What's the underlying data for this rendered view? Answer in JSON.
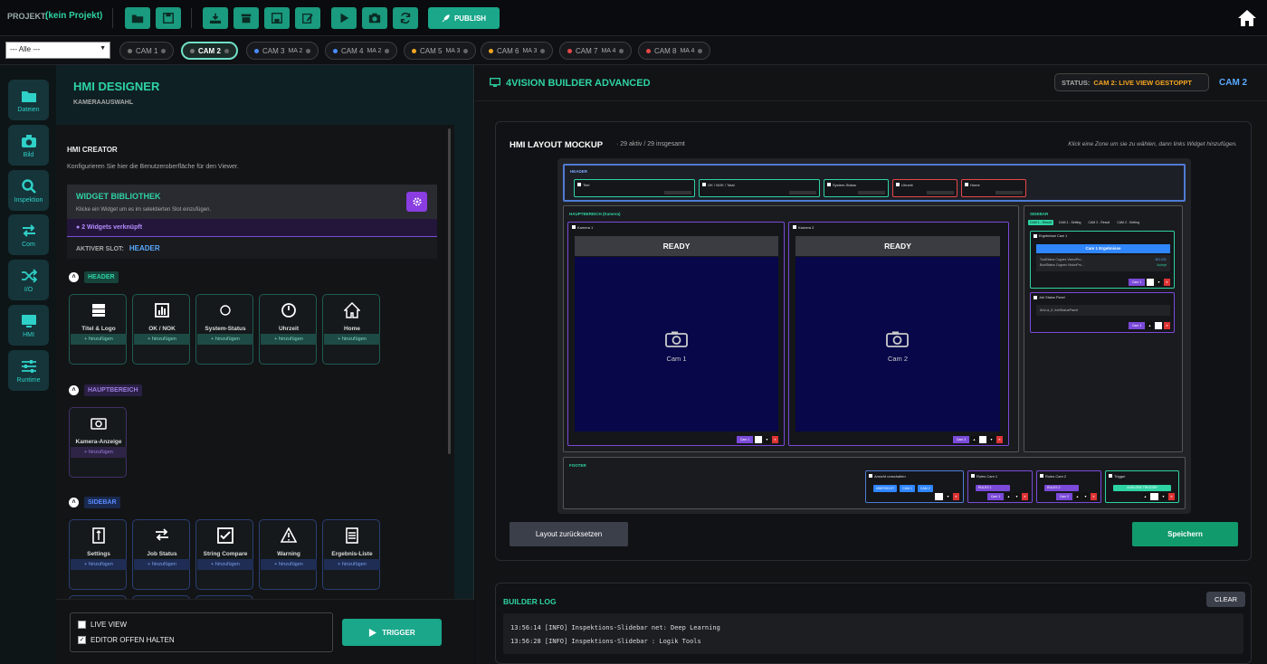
{
  "topbar": {
    "project_label": "PROJEKT:",
    "project_name": "(kein Projekt)",
    "publish_label": "PUBLISH"
  },
  "camfilter": {
    "selected": "--- Alle ---"
  },
  "camtabs": [
    {
      "label": "CAM 1",
      "ma": "",
      "dot": "#777777",
      "active": false
    },
    {
      "label": "CAM 2",
      "ma": "",
      "dot": "#777777",
      "active": true
    },
    {
      "label": "CAM 3",
      "ma": "MA 2",
      "dot": "#4a8cff",
      "active": false
    },
    {
      "label": "CAM 4",
      "ma": "MA 2",
      "dot": "#4a8cff",
      "active": false
    },
    {
      "label": "CAM 5",
      "ma": "MA 3",
      "dot": "#f5a623",
      "active": false
    },
    {
      "label": "CAM 6",
      "ma": "MA 3",
      "dot": "#f5a623",
      "active": false
    },
    {
      "label": "CAM 7",
      "ma": "MA 4",
      "dot": "#e54848",
      "active": false
    },
    {
      "label": "CAM 8",
      "ma": "MA 4",
      "dot": "#e54848",
      "active": false
    }
  ],
  "sidenav": [
    {
      "label": "Dateien",
      "icon": "folder-icon"
    },
    {
      "label": "Bild",
      "icon": "camera-icon"
    },
    {
      "label": "Inspektion",
      "icon": "search-icon"
    },
    {
      "label": "Com",
      "icon": "exchange-icon"
    },
    {
      "label": "I/O",
      "icon": "shuffle-icon"
    },
    {
      "label": "HMI",
      "icon": "monitor-icon"
    },
    {
      "label": "Runtime",
      "icon": "sliders-icon"
    }
  ],
  "designer": {
    "title": "HMI DESIGNER",
    "subtitle": "KAMERAAUSWAHL",
    "creator_title": "HMI CREATOR",
    "creator_desc": "Konfigurieren Sie hier die Benutzeroberfläche für den Viewer.",
    "library_title": "WIDGET BIBLIOTHEK",
    "library_desc": "Klicke ein Widget um es im selektierten Slot einzufügen.",
    "linked": "2 Widgets verknüpft",
    "active_slot_label": "AKTIVER SLOT:",
    "active_slot_value": "HEADER",
    "add_label": "+ hinzufügen",
    "sections": [
      {
        "label": "HEADER",
        "widgets": [
          "Titel & Logo",
          "OK / NOK",
          "System-Status",
          "Uhrzeit",
          "Home"
        ]
      },
      {
        "label": "HAUPTBEREICH",
        "widgets": [
          "Kamera-Anzeige"
        ]
      },
      {
        "label": "SIDEBAR",
        "widgets": [
          "Settings",
          "Job Status",
          "String Compare",
          "Warning",
          "Ergebnis-Liste"
        ]
      }
    ],
    "live_view": "LIVE VIEW",
    "live_view_checked": false,
    "editor_open": "EDITOR OFFEN HALTEN",
    "editor_open_checked": true,
    "trigger": "TRIGGER"
  },
  "main": {
    "title": "4VISION BUILDER ADVANCED",
    "status_label": "STATUS:",
    "status_value": "CAM 2: LIVE VIEW GESTOPPT",
    "cam_label": "CAM 2",
    "mock_title": "HMI LAYOUT MOCKUP",
    "mock_count": "· 29 aktiv / 29 insgesamt",
    "mock_hint": "Klick eine Zone um sie zu wählen, dann links Widget hinzufügen.",
    "zone_header": "HEADER",
    "header_widgets": [
      "Titel",
      "OK / NOK / Total",
      "System-Status",
      "Uhrzeit",
      "Home"
    ],
    "zone_main": "HAUPTBEREICH (Kamera)",
    "cams": [
      {
        "title": "Kamera 1",
        "state": "READY",
        "label": "Cam 1",
        "tag": "Cam 1"
      },
      {
        "title": "Kamera 2",
        "state": "READY",
        "label": "Cam 2",
        "tag": "Cam 2"
      }
    ],
    "zone_sidebar": "SIDEBAR",
    "sidebar_tabs": [
      "CAM 1 - Result",
      "CAM 1 - Setting",
      "CAM 2 - Result",
      "CAM 2 - Setting"
    ],
    "sidebar_result_title": "Ergebnisse Cam 1",
    "sidebar_result_head": "Cam 1 Ergebnisse",
    "sidebar_result_rows": [
      {
        "k": "ToolStatus Cognex VisionPro...",
        "v": "401.031"
      },
      {
        "k": "BoolStatus Cognex VisionPro...",
        "v": "Accept"
      }
    ],
    "sidebar_job_title": "Job Status Panel",
    "sidebar_job_text": "Äöü-à_ß JobStatusPanel",
    "sidebar_tag": "Cam 1",
    "zone_footer": "FOOTER",
    "footer_widgets": [
      {
        "title": "Ansicht umschalten",
        "buttons": [
          "ÜBERSICHT",
          "CAM 1",
          "CAM 2"
        ]
      },
      {
        "title": "Rules Cam 1",
        "buttons": [
          "RULES 1"
        ],
        "tag": "Cam 1"
      },
      {
        "title": "Rules Cam 2",
        "buttons": [
          "RULES 2"
        ],
        "tag": "Cam 2"
      },
      {
        "title": "Trigger",
        "buttons": [
          "AUSLÖSE TRIGGER"
        ]
      }
    ],
    "reset_label": "Layout zurücksetzen",
    "save_label": "Speichern",
    "log_title": "BUILDER LOG",
    "clear_label": "CLEAR",
    "log_lines": [
      "13:56:14 [INFO] Inspektions-Slidebar net: Deep Learning",
      "13:56:28 [INFO] Inspektions-Slidebar : Logik Tools"
    ]
  },
  "colors": {
    "accent": "#2ed3a4",
    "header_zone": "#4f7bd4",
    "purple": "#7b4ad9",
    "status_orange": "#f5a623"
  }
}
